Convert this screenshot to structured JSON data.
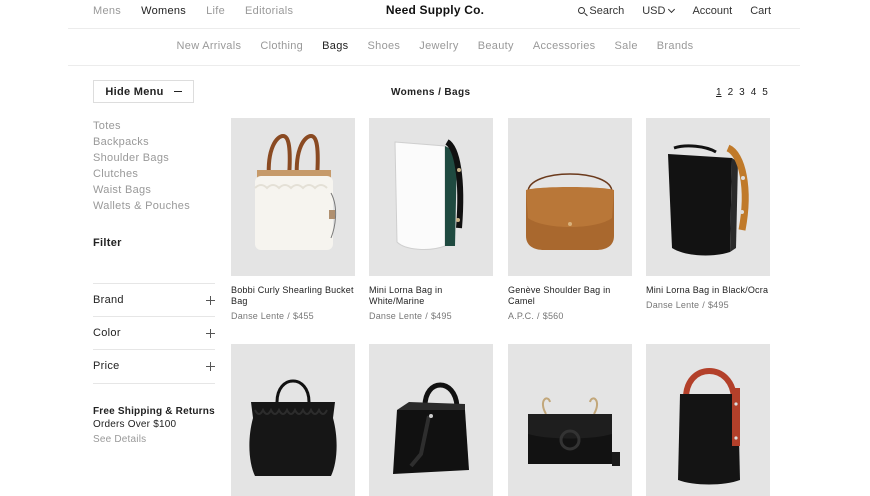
{
  "header": {
    "left_nav": [
      "Mens",
      "Womens",
      "Life",
      "Editorials"
    ],
    "left_nav_active": "Womens",
    "brand": "Need Supply Co.",
    "search": "Search",
    "currency": "USD",
    "account": "Account",
    "cart": "Cart"
  },
  "category_nav": {
    "items": [
      "New Arrivals",
      "Clothing",
      "Bags",
      "Shoes",
      "Jewelry",
      "Beauty",
      "Accessories",
      "Sale",
      "Brands"
    ],
    "active": "Bags"
  },
  "sidebar": {
    "hide_menu": "Hide Menu",
    "subcategories": [
      "Totes",
      "Backpacks",
      "Shoulder Bags",
      "Clutches",
      "Waist Bags",
      "Wallets & Pouches"
    ],
    "filter_title": "Filter",
    "facets": [
      "Brand",
      "Color",
      "Price"
    ],
    "shipping_title": "Free Shipping & Returns",
    "shipping_sub": "Orders Over $100",
    "see_details": "See Details"
  },
  "listing": {
    "breadcrumb": "Womens / Bags",
    "pages": [
      "1",
      "2",
      "3",
      "4",
      "5"
    ],
    "current_page": "1",
    "products": [
      {
        "name": "Bobbi Curly Shearling Bucket Bag",
        "brand": "Danse Lente",
        "price": "$455",
        "image": "shearling-bucket-bag"
      },
      {
        "name": "Mini Lorna Bag in White/Marine",
        "brand": "Danse Lente",
        "price": "$495",
        "image": "white-bucket-bag"
      },
      {
        "name": "Genève Shoulder Bag in Camel",
        "brand": "A.P.C.",
        "price": "$560",
        "image": "camel-saddle-bag"
      },
      {
        "name": "Mini Lorna Bag in Black/Ocra",
        "brand": "Danse Lente",
        "price": "$495",
        "image": "black-ocra-bucket-bag"
      },
      {
        "name": "",
        "brand": "",
        "price": "",
        "image": "black-gathered-tote"
      },
      {
        "name": "",
        "brand": "",
        "price": "",
        "image": "black-structured-tote"
      },
      {
        "name": "",
        "brand": "",
        "price": "",
        "image": "black-ring-shoulder-bag"
      },
      {
        "name": "",
        "brand": "",
        "price": "",
        "image": "black-red-bucket-bag"
      }
    ]
  },
  "colors": {
    "accent_text": "#222222",
    "muted_text": "#999999",
    "tile_bg": "#e4e4e4"
  }
}
